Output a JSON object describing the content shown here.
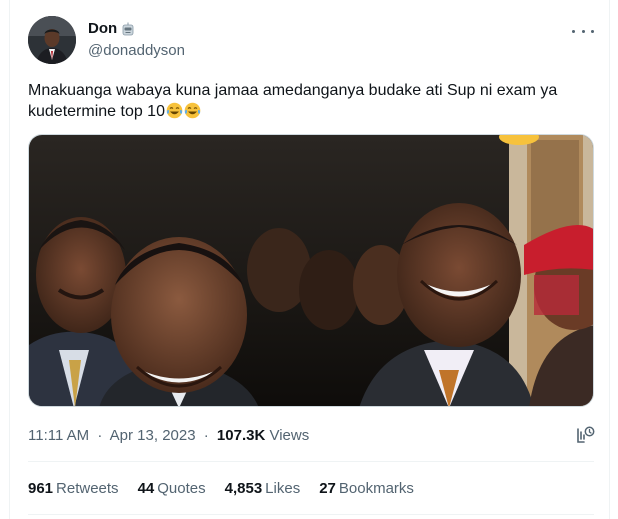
{
  "tweet": {
    "author": {
      "display_name": "Don",
      "handle": "@donaddyson"
    },
    "text": "Mnakuanga wabaya kuna jamaa amedanganya budake ati Sup ni exam ya kudetermine top 10",
    "time": "11:11 AM",
    "date": "Apr 13, 2023",
    "separator": "·",
    "views_count": "107.3K",
    "views_label": "Views"
  },
  "stats": {
    "retweets": {
      "count": "961",
      "label": "Retweets"
    },
    "quotes": {
      "count": "44",
      "label": "Quotes"
    },
    "likes": {
      "count": "4,853",
      "label": "Likes"
    },
    "bookmarks": {
      "count": "27",
      "label": "Bookmarks"
    }
  },
  "icons": {
    "more": "more-dots-icon",
    "analytics": "analytics-icon",
    "name_emoji": "robot-face-emoji",
    "text_emoji": "tears-of-joy-emoji"
  },
  "colors": {
    "text_primary": "#0f1419",
    "text_secondary": "#536471",
    "divider": "#eff3f4",
    "emoji_yellow": "#f7c23c"
  }
}
